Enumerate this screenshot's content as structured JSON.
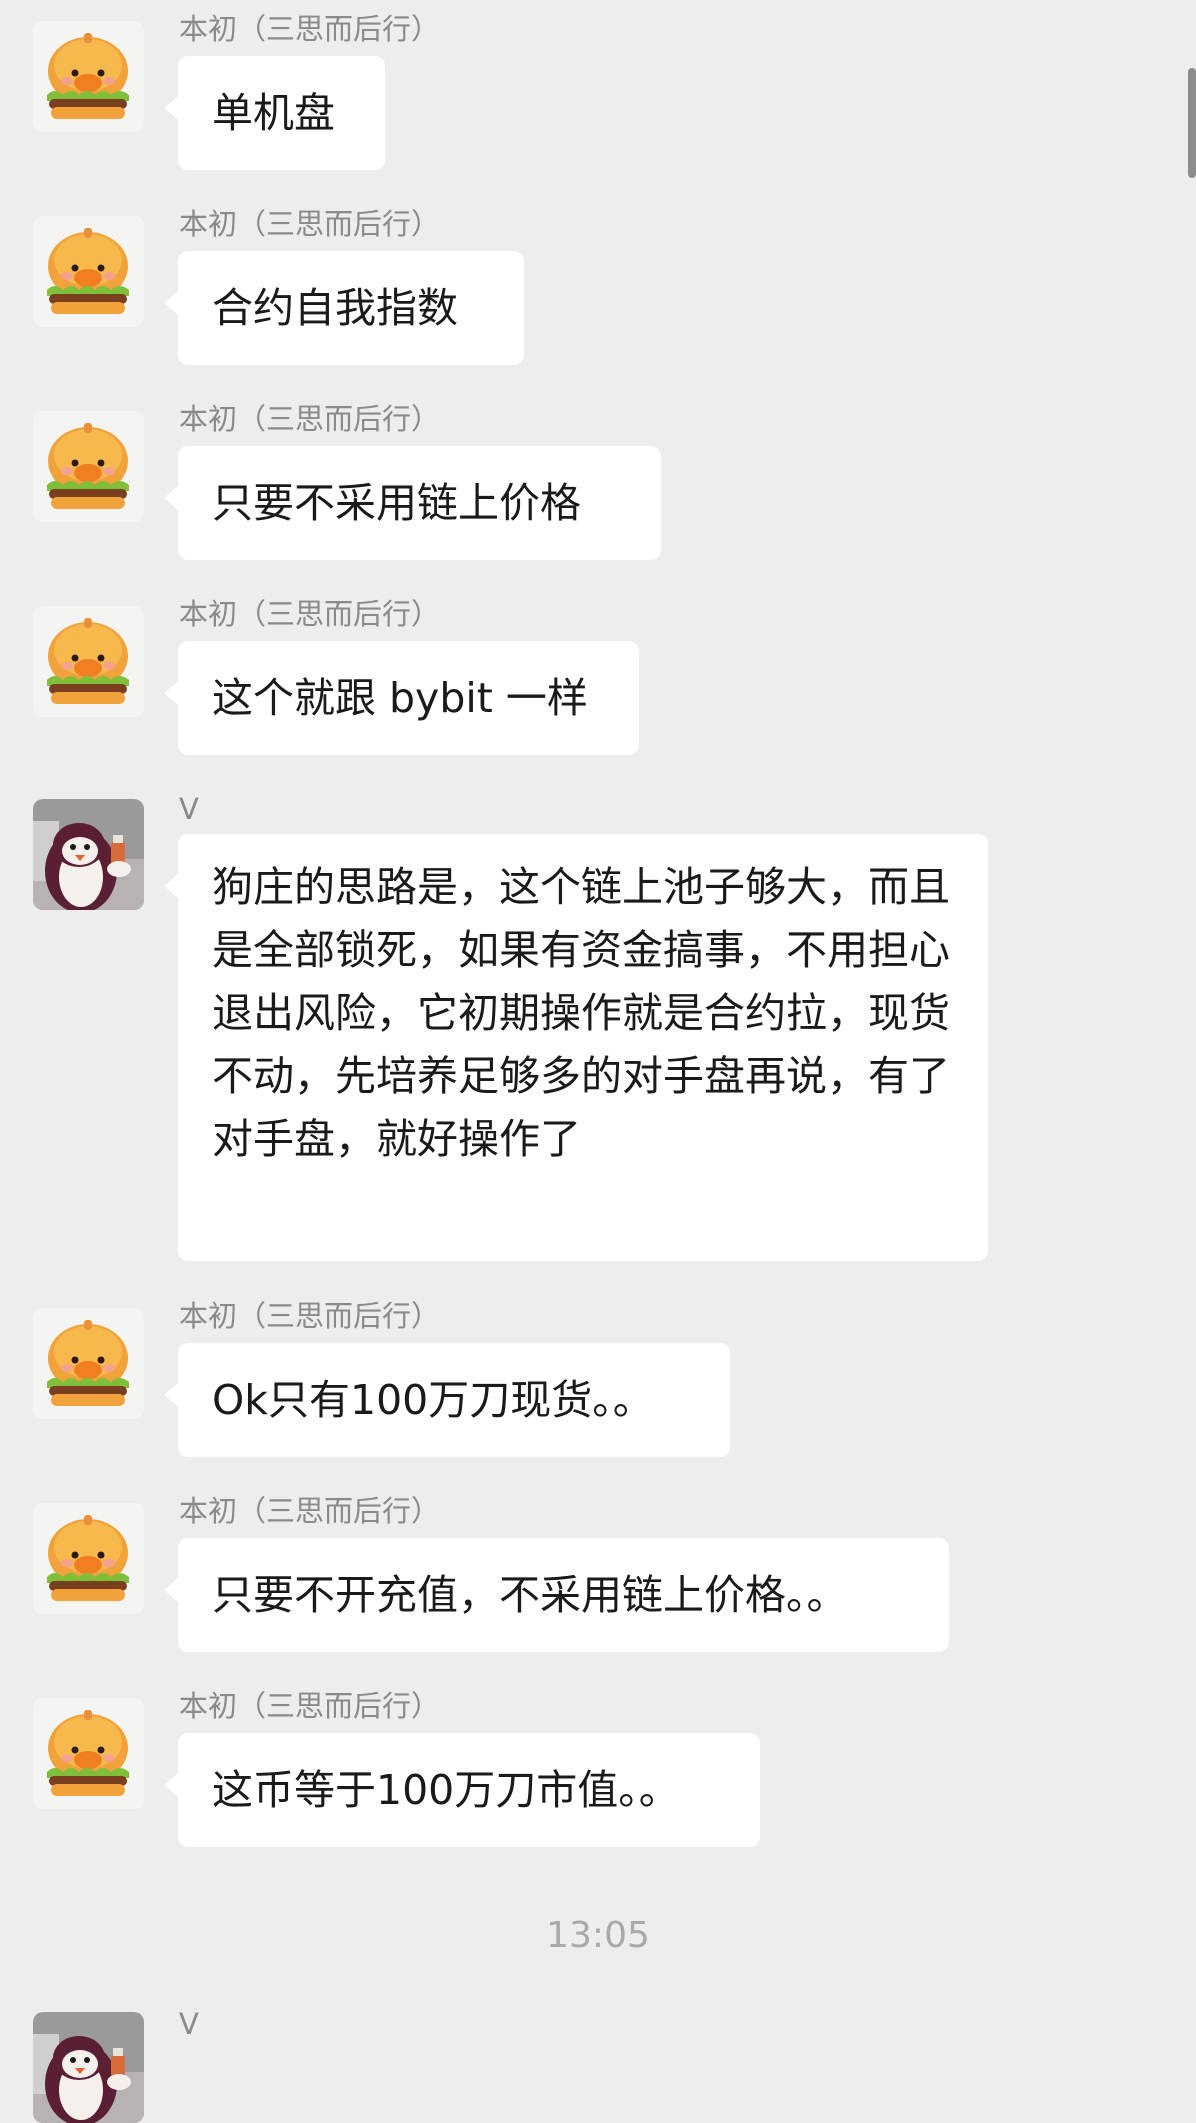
{
  "chat": {
    "messages": [
      {
        "sender": "本初（三思而后行）",
        "text": "单机盘"
      },
      {
        "sender": "本初（三思而后行）",
        "text": "合约自我指数"
      },
      {
        "sender": "本初（三思而后行）",
        "text": "只要不采用链上价格"
      },
      {
        "sender": "本初（三思而后行）",
        "text": "这个就跟 bybit 一样"
      },
      {
        "sender": "V",
        "text": "狗庄的思路是，这个链上池子够大，而且是全部锁死，如果有资金搞事，不用担心退出风险，它初期操作就是合约拉，现货不动，先培养足够多的对手盘再说，有了对手盘，就好操作了"
      },
      {
        "sender": "本初（三思而后行）",
        "text": "Ok只有100万刀现货。。"
      },
      {
        "sender": "本初（三思而后行）",
        "text": "只要不开充值，不采用链上价格。。"
      },
      {
        "sender": "本初（三思而后行）",
        "text": "这币等于100万刀市值。。"
      }
    ],
    "timestamp": "13:05",
    "last_sender": "V"
  },
  "icons": {
    "avatar_burger": "burger-duck-avatar-icon",
    "avatar_penguin": "penguin-avatar-icon"
  },
  "colors": {
    "background": "#ededed",
    "bubble": "#ffffff",
    "sender_text": "#8a8a8a",
    "timestamp_text": "#a9a9a9"
  }
}
